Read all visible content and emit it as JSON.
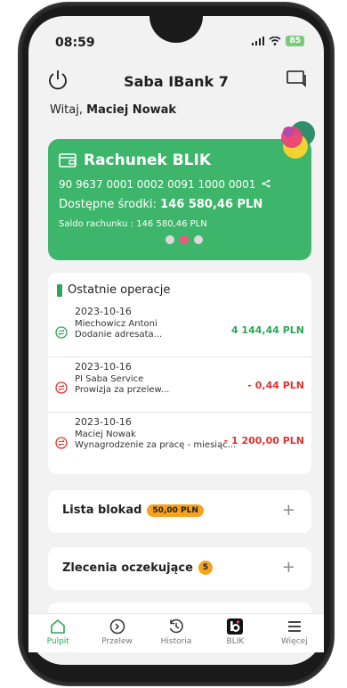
{
  "status": {
    "time": "08:59",
    "battery": "85"
  },
  "header": {
    "title": "Saba IBank 7"
  },
  "welcome": {
    "prefix": "Witaj,",
    "name": "Maciej Nowak"
  },
  "blik_card": {
    "title": "Rachunek BLIK",
    "account_number": "90 9637 0001 0002 0091 1000 0001",
    "available_label": "Dostępne środki:",
    "available_value": "146 580,46 PLN",
    "balance_text": "Saldo rachunku : 146 580,46 PLN",
    "pager_active": 2,
    "pager_total": 3
  },
  "operations": {
    "title": "Ostatnie operacje",
    "items": [
      {
        "date": "2023-10-16",
        "name": "Miechowicz Antoni",
        "desc": "Dodanie adresata...",
        "amount": "4 144,44 PLN",
        "kind": "incoming"
      },
      {
        "date": "2023-10-16",
        "name": "PI Saba Service",
        "desc": "Prowizja za przelew...",
        "amount": "- 0,44 PLN",
        "kind": "outgoing"
      },
      {
        "date": "2023-10-16",
        "name": "Maciej Nowak",
        "desc": "Wynagrodzenie za pracę - miesiąc...",
        "amount": "- 1 200,00 PLN",
        "kind": "outgoing"
      }
    ]
  },
  "blocks": {
    "label": "Lista blokad",
    "badge": "50,00 PLN"
  },
  "pending": {
    "label": "Zlecenia oczekujące",
    "badge": "5"
  },
  "tabs": [
    {
      "label": "Pulpit",
      "icon": "home-icon",
      "active": true
    },
    {
      "label": "Przelew",
      "icon": "transfer-icon",
      "active": false
    },
    {
      "label": "Historia",
      "icon": "history-icon",
      "active": false
    },
    {
      "label": "BLIK",
      "icon": "blik-icon",
      "active": false
    },
    {
      "label": "Więcej",
      "icon": "menu-icon",
      "active": false
    }
  ],
  "colors": {
    "brand_green": "#3db56b",
    "negative": "#e03232",
    "badge": "#f5a21e"
  }
}
